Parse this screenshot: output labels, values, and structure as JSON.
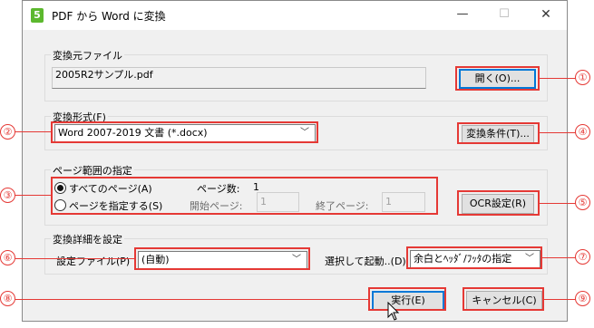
{
  "window": {
    "title": "PDF から Word に変換",
    "app_icon_glyph": "5",
    "min_glyph": "—",
    "max_glyph": "☐",
    "close_glyph": "✕"
  },
  "source": {
    "legend": "変換元ファイル",
    "file_value": "2005R2サンプル.pdf",
    "open_button": "開く(O)..."
  },
  "format": {
    "legend": "変換形式(F)",
    "selected": "Word 2007-2019 文書 (*.docx)",
    "conditions_button": "変換条件(T)..."
  },
  "page_range": {
    "legend": "ページ範囲の指定",
    "all_pages": "すべてのページ(A)",
    "specify_pages": "ページを指定する(S)",
    "page_count_label": "ページ数:",
    "page_count_value": "1",
    "start_label": "開始ページ:",
    "start_value": "1",
    "end_label": "終了ページ:",
    "end_value": "1",
    "ocr_button": "OCR設定(R)"
  },
  "details": {
    "legend": "変換詳細を設定",
    "settings_file_label": "設定ファイル(P)",
    "settings_file_value": "(自動)",
    "select_launch_label": "選択して起動..(D)",
    "select_launch_value": "余白とﾍｯﾀﾞ/ﾌｯﾀの指定"
  },
  "footer": {
    "run_button": "実行(E)",
    "cancel_button": "キャンセル(C)"
  },
  "markers": [
    "①",
    "②",
    "③",
    "④",
    "⑤",
    "⑥",
    "⑦",
    "⑧",
    "⑨"
  ],
  "colors": {
    "callout": "#e53935",
    "default_button_border": "#0078d7",
    "dialog_bg": "#f0f0f0"
  },
  "icons": {
    "dropdown": "chevron-down-icon",
    "app": "app-logo-icon",
    "cursor": "mouse-pointer-icon"
  }
}
